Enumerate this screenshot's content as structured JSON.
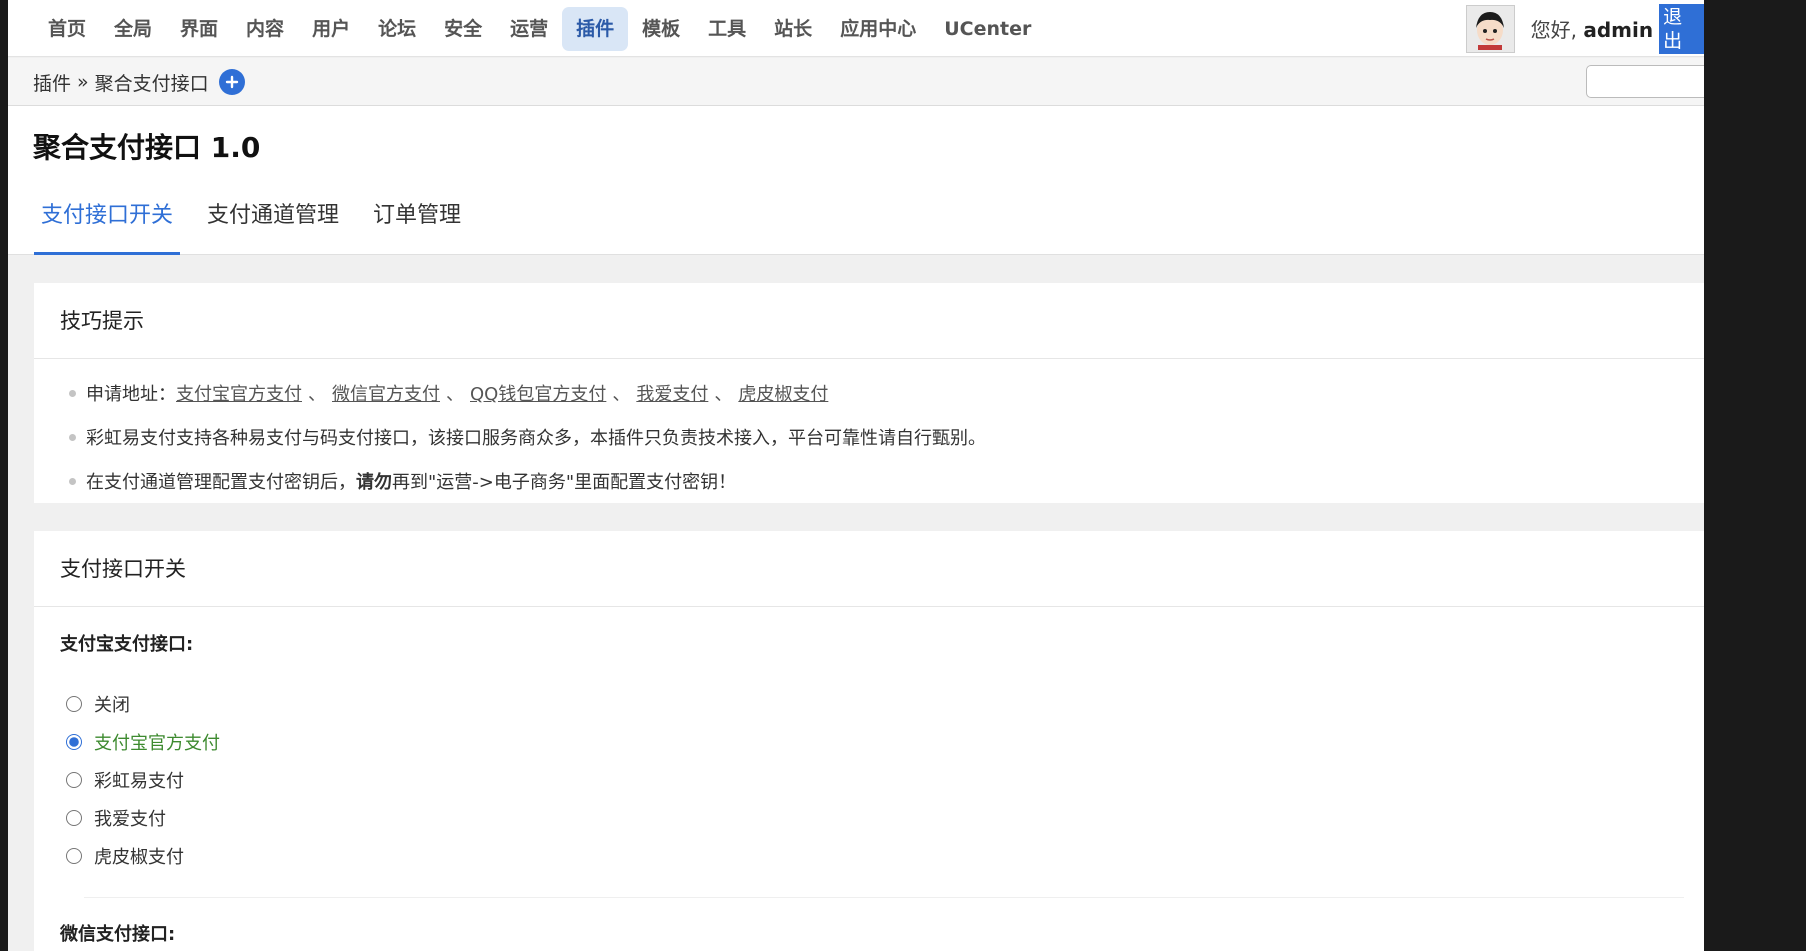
{
  "nav": {
    "items": [
      "首页",
      "全局",
      "界面",
      "内容",
      "用户",
      "论坛",
      "安全",
      "运营",
      "插件",
      "模板",
      "工具",
      "站长",
      "应用中心",
      "UCenter"
    ],
    "active": "插件"
  },
  "user": {
    "greeting_prefix": "您好, ",
    "username": "admin",
    "logout_label": "退出"
  },
  "breadcrumb": {
    "parent": "插件",
    "separator": "»",
    "current": "聚合支付接口"
  },
  "search": {
    "value": ""
  },
  "page": {
    "title": "聚合支付接口 1.0"
  },
  "tabs": [
    {
      "label": "支付接口开关",
      "active": true
    },
    {
      "label": "支付通道管理",
      "active": false
    },
    {
      "label": "订单管理",
      "active": false
    }
  ],
  "tips": {
    "heading": "技巧提示",
    "apply_prefix": "申请地址：",
    "links": [
      "支付宝官方支付",
      "微信官方支付",
      "QQ钱包官方支付",
      "我爱支付",
      "虎皮椒支付"
    ],
    "link_separator": "、",
    "line2": "彩虹易支付支持各种易支付与码支付接口，该接口服务商众多，本插件只负责技术接入，平台可靠性请自行甄别。",
    "line3_before": "在支付通道管理配置支付密钥后，",
    "line3_bold": "请勿",
    "line3_after": "再到\"运营->电子商务\"里面配置支付密钥！"
  },
  "switch_panel": {
    "heading": "支付接口开关",
    "alipay_label": "支付宝支付接口:",
    "alipay_options": [
      "关闭",
      "支付宝官方支付",
      "彩虹易支付",
      "我爱支付",
      "虎皮椒支付"
    ],
    "alipay_selected": "支付宝官方支付",
    "wechat_label": "微信支付接口:"
  },
  "colors": {
    "accent": "#2f6fd6",
    "nav_active_bg": "#d9e6f6",
    "selected_option": "#3d8a2f"
  }
}
